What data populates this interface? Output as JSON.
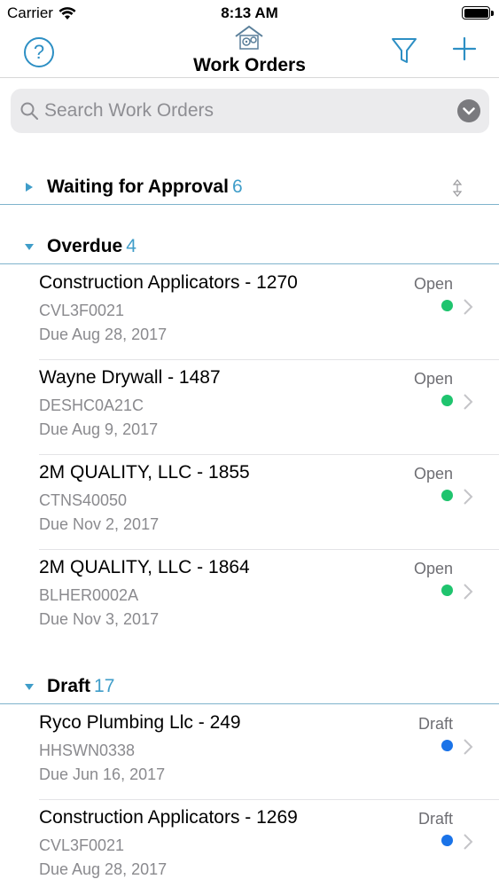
{
  "status_bar": {
    "carrier": "Carrier",
    "time": "8:13 AM"
  },
  "nav": {
    "title": "Work Orders",
    "help_label": "?",
    "icons": [
      "help-icon",
      "app-logo-icon",
      "filter-icon",
      "add-icon"
    ]
  },
  "search": {
    "placeholder": "Search Work Orders"
  },
  "colors": {
    "accent": "#2d8fc4",
    "count": "#3f9dc9",
    "open_dot": "#1fc46e",
    "draft_dot": "#1a73e8"
  },
  "sections": [
    {
      "title": "Waiting for Approval",
      "count": "6",
      "expanded": false,
      "rows": []
    },
    {
      "title": "Overdue",
      "count": "4",
      "expanded": true,
      "rows": [
        {
          "title": "Construction Applicators - 1270",
          "code": "CVL3F0021",
          "due": "Due Aug 28, 2017",
          "status": "Open"
        },
        {
          "title": "Wayne Drywall - 1487",
          "code": "DESHC0A21C",
          "due": "Due Aug 9, 2017",
          "status": "Open"
        },
        {
          "title": "2M QUALITY, LLC - 1855",
          "code": "CTNS40050",
          "due": "Due Nov 2, 2017",
          "status": "Open"
        },
        {
          "title": "2M QUALITY, LLC - 1864",
          "code": "BLHER0002A",
          "due": "Due Nov 3, 2017",
          "status": "Open"
        }
      ]
    },
    {
      "title": "Draft",
      "count": "17",
      "expanded": true,
      "rows": [
        {
          "title": "Ryco Plumbing Llc - 249",
          "code": "HHSWN0338",
          "due": "Due Jun 16, 2017",
          "status": "Draft"
        },
        {
          "title": "Construction Applicators - 1269",
          "code": "CVL3F0021",
          "due": "Due Aug 28, 2017",
          "status": "Draft"
        }
      ]
    }
  ]
}
